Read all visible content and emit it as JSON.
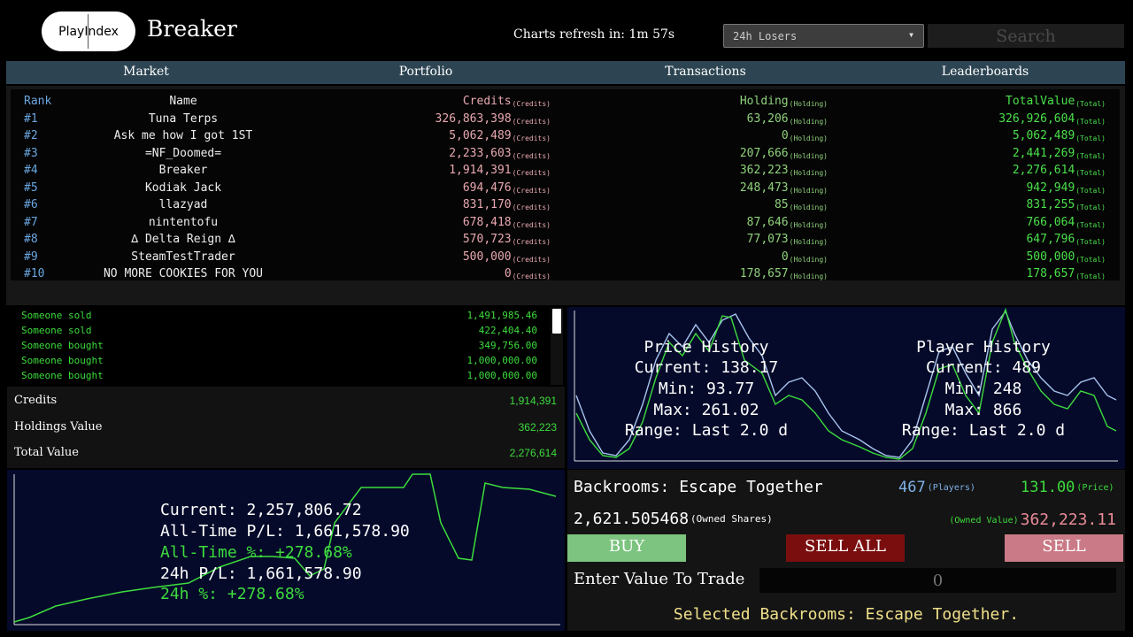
{
  "header": {
    "logo_text": "PlayIndex",
    "title": "Breaker",
    "refresh_text": "Charts refresh in: 1m 57s",
    "chart_select_value": "24h Losers",
    "search_placeholder": "Search"
  },
  "nav": {
    "tabs": [
      "Market",
      "Portfolio",
      "Transactions",
      "Leaderboards"
    ]
  },
  "leaderboard": {
    "headers": {
      "rank": "Rank",
      "name": "Name",
      "credits": "Credits",
      "holding": "Holding",
      "total": "TotalValue"
    },
    "tags": {
      "credits": "(Credits)",
      "holding": "(Holding)",
      "total": "(Total)"
    },
    "rows": [
      {
        "rank": "#1",
        "name": "Tuna Terps",
        "credits": "326,863,398",
        "holding": "63,206",
        "total": "326,926,604"
      },
      {
        "rank": "#2",
        "name": "Ask me how I got 1ST",
        "credits": "5,062,489",
        "holding": "0",
        "total": "5,062,489"
      },
      {
        "rank": "#3",
        "name": "=NF_Doomed=",
        "credits": "2,233,603",
        "holding": "207,666",
        "total": "2,441,269"
      },
      {
        "rank": "#4",
        "name": "Breaker",
        "credits": "1,914,391",
        "holding": "362,223",
        "total": "2,276,614"
      },
      {
        "rank": "#5",
        "name": "Kodiak Jack",
        "credits": "694,476",
        "holding": "248,473",
        "total": "942,949"
      },
      {
        "rank": "#6",
        "name": "llazyad",
        "credits": "831,170",
        "holding": "85",
        "total": "831,255"
      },
      {
        "rank": "#7",
        "name": "nintentofu",
        "credits": "678,418",
        "holding": "87,646",
        "total": "766,064"
      },
      {
        "rank": "#8",
        "name": "∆ Delta Reign ∆",
        "credits": "570,723",
        "holding": "77,073",
        "total": "647,796"
      },
      {
        "rank": "#9",
        "name": "SteamTestTrader",
        "credits": "500,000",
        "holding": "0",
        "total": "500,000"
      },
      {
        "rank": "#10",
        "name": "NO MORE COOKIES FOR YOU",
        "credits": "0",
        "holding": "178,657",
        "total": "178,657"
      }
    ]
  },
  "transactions": [
    {
      "text": "Someone sold",
      "amount": "1,491,985.46"
    },
    {
      "text": "Someone sold",
      "amount": "422,404.40"
    },
    {
      "text": "Someone bought",
      "amount": "349,756.00"
    },
    {
      "text": "Someone bought",
      "amount": "1,000,000.00"
    },
    {
      "text": "Someone bought",
      "amount": "1,000,000.00"
    }
  ],
  "stats": {
    "credits_label": "Credits",
    "credits_value": "1,914,391",
    "holdings_label": "Holdings Value",
    "holdings_value": "362,223",
    "total_label": "Total Value",
    "total_value": "2,276,614"
  },
  "portfolio_overlay": {
    "current": "Current: 2,257,806.72",
    "alltime_pl": "All-Time P/L: 1,661,578.90",
    "alltime_pct": "All-Time %: +278.68%",
    "day_pl": "24h P/L: 1,661,578.90",
    "day_pct": "24h %: +278.68%"
  },
  "history_overlay": {
    "price_title": "Price History",
    "price_current": "Current: 138.17",
    "price_min": "Min: 93.77",
    "price_max": "Max: 261.02",
    "price_range": "Range: Last 2.0 d",
    "player_title": "Player History",
    "player_current": "Current: 489",
    "player_min": "Min: 248",
    "player_max": "Max: 866",
    "player_range": "Range: Last 2.0 d"
  },
  "trade": {
    "game_name": "Backrooms: Escape Together",
    "players_value": "467",
    "players_tag": "(Players)",
    "price_value": "131.00",
    "price_tag": "(Price)",
    "shares_value": "2,621.505468",
    "shares_tag": "(Owned Shares)",
    "owned_value_tag": "(Owned Value)",
    "owned_value": "362,223.11",
    "buy_label": "BUY",
    "sell_all_label": "SELL ALL",
    "sell_label": "SELL",
    "enter_label": "Enter Value To Trade",
    "input_placeholder": "0",
    "selected_text": "Selected Backrooms: Escape Together."
  },
  "colors": {
    "nav_bar": "#2d4553",
    "chart_bg": "#050a2a",
    "green": "#3ddc3d",
    "blue_line": "#a8c4ee",
    "buy": "#7cc47f",
    "sell_all": "#7a0e0e",
    "sell": "#c97a86"
  }
}
